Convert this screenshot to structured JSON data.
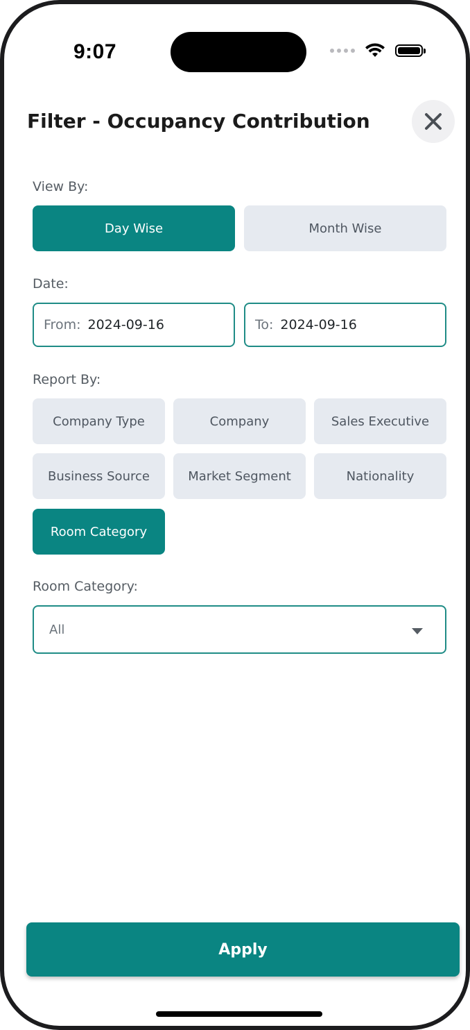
{
  "status_bar": {
    "time": "9:07",
    "wifi_icon": "wifi-icon",
    "battery_icon": "battery-icon"
  },
  "header": {
    "title": "Filter - Occupancy Contribution",
    "close_icon": "close-icon"
  },
  "view_by": {
    "label": "View By:",
    "options": [
      {
        "label": "Day Wise",
        "selected": true
      },
      {
        "label": "Month Wise",
        "selected": false
      }
    ]
  },
  "date": {
    "label": "Date:",
    "from_prefix": "From:",
    "from_value": "2024-09-16",
    "to_prefix": "To:",
    "to_value": "2024-09-16"
  },
  "report_by": {
    "label": "Report By:",
    "options": [
      {
        "label": "Company Type",
        "selected": false
      },
      {
        "label": "Company",
        "selected": false
      },
      {
        "label": "Sales Executive",
        "selected": false
      },
      {
        "label": "Business Source",
        "selected": false
      },
      {
        "label": "Market Segment",
        "selected": false
      },
      {
        "label": "Nationality",
        "selected": false
      },
      {
        "label": "Room Category",
        "selected": true
      }
    ]
  },
  "room_category": {
    "label": "Room Category:",
    "selected_value": "All",
    "dropdown_icon": "chevron-down-icon"
  },
  "footer": {
    "apply_label": "Apply"
  },
  "colors": {
    "accent": "#0a8582",
    "chip_bg": "#e6eaf0",
    "border": "#1f8c86"
  }
}
